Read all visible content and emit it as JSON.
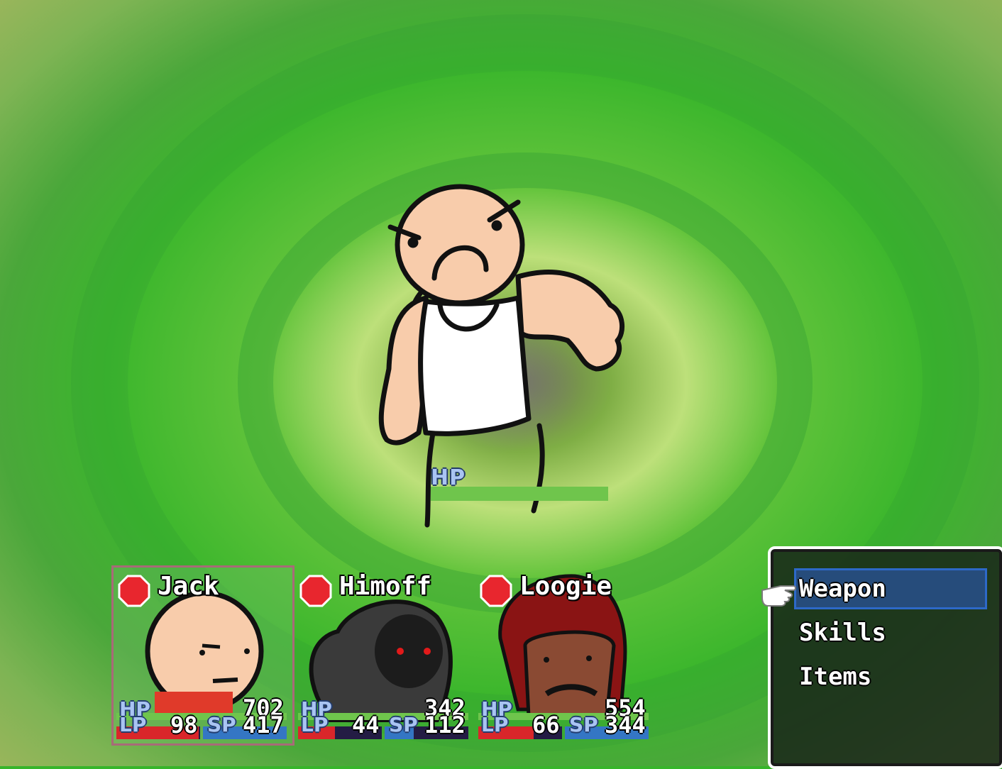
{
  "enemy": {
    "hp_label": "HP",
    "hp_fraction": 1.0
  },
  "party": [
    {
      "name": "Jack",
      "hp_label": "HP",
      "hp": "702",
      "lp_label": "LP",
      "lp": "98",
      "sp_label": "SP",
      "sp": "417",
      "hp_fraction": 1.0,
      "lp_fraction": 0.98,
      "sp_fraction": 1.0,
      "selected": true
    },
    {
      "name": "Himoff",
      "hp_label": "HP",
      "hp": "342",
      "lp_label": "LP",
      "lp": "44",
      "sp_label": "SP",
      "sp": "112",
      "hp_fraction": 1.0,
      "lp_fraction": 0.44,
      "sp_fraction": 0.35,
      "selected": false
    },
    {
      "name": "Loogie",
      "hp_label": "HP",
      "hp": "554",
      "lp_label": "LP",
      "lp": "66",
      "sp_label": "SP",
      "sp": "344",
      "hp_fraction": 1.0,
      "lp_fraction": 0.66,
      "sp_fraction": 1.0,
      "selected": false
    }
  ],
  "commands": {
    "items": [
      "Weapon",
      "Skills",
      "Items"
    ],
    "selected": "Weapon"
  },
  "colors": {
    "background": "#37b52a",
    "hp_label": "#a9c4f2",
    "hp_bar": "#6fc54c",
    "lp_bar": "#d9262a",
    "sp_bar": "#3476c4",
    "state_icon": "#e8262e"
  }
}
